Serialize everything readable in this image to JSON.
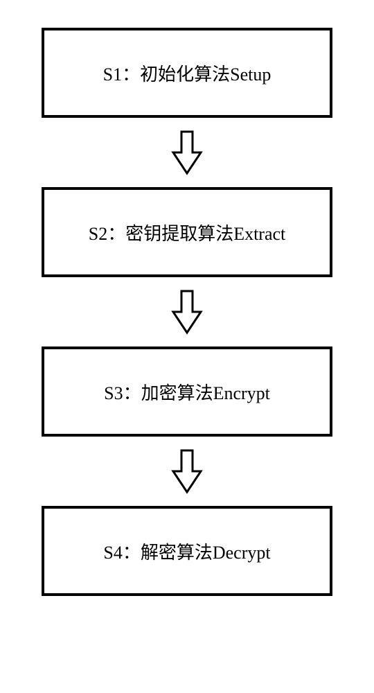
{
  "chart_data": {
    "type": "flowchart",
    "direction": "vertical",
    "steps": [
      {
        "id": "S1",
        "label": "S1：初始化算法Setup"
      },
      {
        "id": "S2",
        "label": "S2：密钥提取算法Extract"
      },
      {
        "id": "S3",
        "label": "S3：加密算法Encrypt"
      },
      {
        "id": "S4",
        "label": "S4：解密算法Decrypt"
      }
    ],
    "connections": [
      {
        "from": "S1",
        "to": "S2"
      },
      {
        "from": "S2",
        "to": "S3"
      },
      {
        "from": "S3",
        "to": "S4"
      }
    ]
  }
}
